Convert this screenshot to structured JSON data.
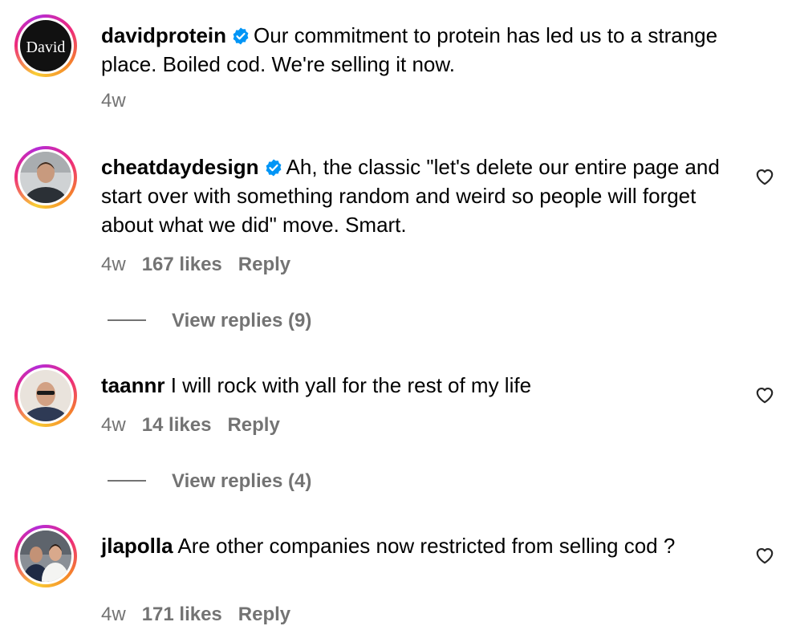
{
  "comments": [
    {
      "username": "davidprotein",
      "verified": true,
      "text": "Our commitment to protein has led us to a strange place. Boiled cod. We're selling it now.",
      "time": "4w",
      "avatar_text": "David"
    },
    {
      "username": "cheatdaydesign",
      "verified": true,
      "text": "Ah, the classic \"let's delete our entire page and start over with something random and weird so people will forget about what we did\" move. Smart.",
      "time": "4w",
      "likes": "167 likes",
      "reply_label": "Reply",
      "view_replies": "View replies (9)"
    },
    {
      "username": "taannr",
      "verified": false,
      "text": "I will rock with yall for the rest of my life",
      "time": "4w",
      "likes": "14 likes",
      "reply_label": "Reply",
      "view_replies": "View replies (4)"
    },
    {
      "username": "jlapolla",
      "verified": false,
      "text": "Are other companies now restricted from selling cod ?",
      "time": "4w",
      "likes": "171 likes",
      "reply_label": "Reply"
    }
  ],
  "colors": {
    "verified": "#0095f6",
    "secondary_text": "#737373"
  },
  "icons": {
    "verified": "verified-badge-icon",
    "like": "heart-icon"
  }
}
